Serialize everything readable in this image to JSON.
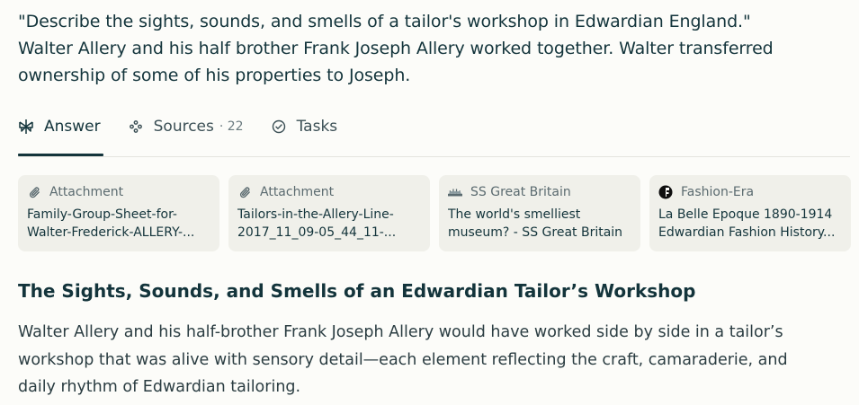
{
  "query": {
    "lines": [
      "\"Describe the sights, sounds, and smells of a tailor's workshop in Edwardian England.\"",
      "Walter Allery and his half brother Frank Joseph Allery worked together. Walter transferred",
      "ownership of some of his properties to Joseph."
    ]
  },
  "tabs": [
    {
      "label": "Answer",
      "icon": "perplexity-icon",
      "active": true
    },
    {
      "label": "Sources",
      "count": "· 22",
      "icon": "sources-icon"
    },
    {
      "label": "Tasks",
      "icon": "check-circle-icon"
    }
  ],
  "sources": [
    {
      "site": "Attachment",
      "icon": "paperclip-icon",
      "title_lines": [
        "Family-Group-Sheet-for-",
        "Walter-Frederick-ALLERY-..."
      ]
    },
    {
      "site": "Attachment",
      "icon": "paperclip-icon",
      "title_lines": [
        "Tailors-in-the-Allery-Line-",
        "2017_11_09-05_44_11-..."
      ]
    },
    {
      "site": "SS Great Britain",
      "icon": "ship-favicon",
      "title_lines": [
        "The world's smelliest",
        "museum? - SS Great Britain"
      ]
    },
    {
      "site": "Fashion-Era",
      "icon": "fashion-era-favicon",
      "title_lines": [
        "La Belle Epoque 1890-1914",
        "Edwardian Fashion History..."
      ]
    }
  ],
  "answer": {
    "heading": "The Sights, Sounds, and Smells of an Edwardian Tailor’s Workshop",
    "paragraph_lines": [
      "Walter Allery and his half-brother Frank Joseph Allery would have worked side by side in a tailor’s",
      "workshop that was alive with sensory detail—each element reflecting the craft, camaraderie, and",
      "daily rhythm of Edwardian tailoring."
    ]
  }
}
